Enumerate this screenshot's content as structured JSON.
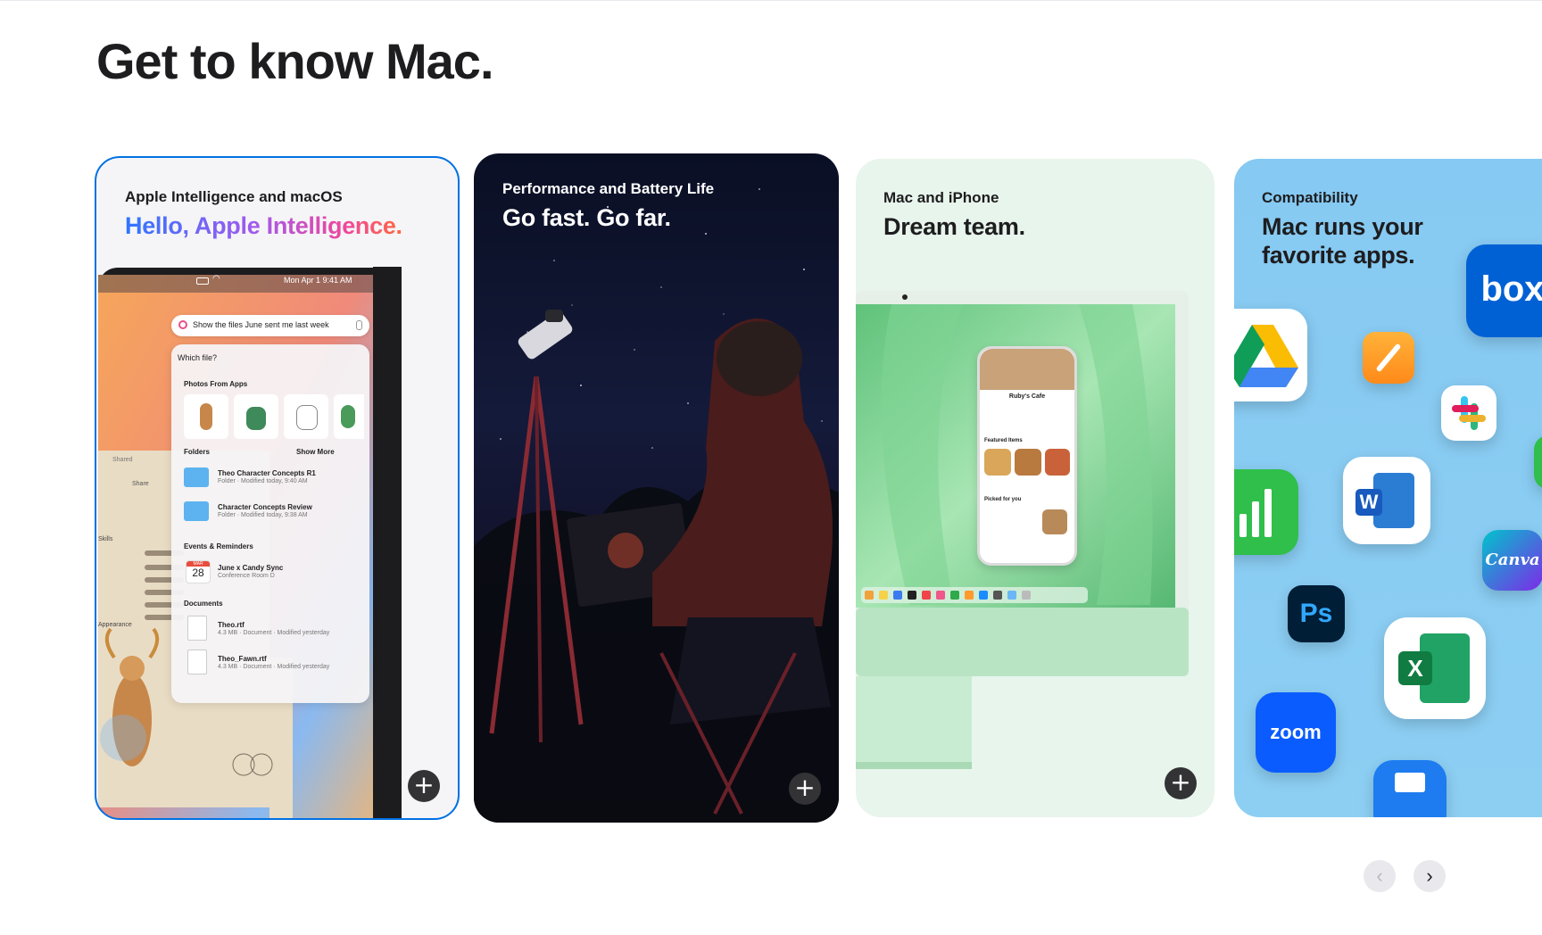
{
  "page": {
    "title": "Get to know Mac."
  },
  "cards": [
    {
      "eyebrow": "Apple Intelligence and macOS",
      "headline": "Hello, Apple Intelligence.",
      "screen": {
        "menubar_time": "Mon Apr 1  9:41 AM",
        "search_query": "Show the files June sent me last week",
        "panel_question": "Which file?",
        "photos_label": "Photos From Apps",
        "folders_label": "Folders",
        "show_more": "Show More",
        "folders": [
          {
            "name": "Theo Character Concepts R1",
            "meta": "Folder · Modified today, 9:40 AM"
          },
          {
            "name": "Character Concepts Review",
            "meta": "Folder · Modified today, 9:38 AM"
          }
        ],
        "events_label": "Events & Reminders",
        "event": {
          "month": "MAR",
          "day": "28",
          "name": "June x Candy Sync",
          "meta": "Conference Room D"
        },
        "documents_label": "Documents",
        "documents": [
          {
            "name": "Theo.rtf",
            "meta": "4.3 MB · Document · Modified yesterday"
          },
          {
            "name": "Theo_Fawn.rtf",
            "meta": "4.3 MB · Document · Modified yesterday"
          }
        ],
        "side_labels": {
          "shared": "Shared",
          "share": "Share",
          "skills": "Skills",
          "appearance": "Appearance"
        }
      }
    },
    {
      "eyebrow": "Performance and Battery Life",
      "headline": "Go fast. Go far."
    },
    {
      "eyebrow": "Mac and iPhone",
      "headline": "Dream team.",
      "phone": {
        "cafe": "Ruby's Cafe",
        "featured": "Featured Items",
        "picked": "Picked for you"
      }
    },
    {
      "eyebrow": "Compatibility",
      "headline_line1": "Mac runs your",
      "headline_line2": "favorite apps.",
      "apps": {
        "box": "box",
        "word": "W",
        "canva": "Canva",
        "ps": "Ps",
        "excel": "X",
        "zoom": "zoom"
      }
    }
  ],
  "controls": {
    "plus_glyph": "+",
    "prev_glyph": "‹",
    "next_glyph": "›"
  },
  "colors": {
    "accent": "#0071e3",
    "text": "#1d1d1f",
    "control": "#333336"
  }
}
